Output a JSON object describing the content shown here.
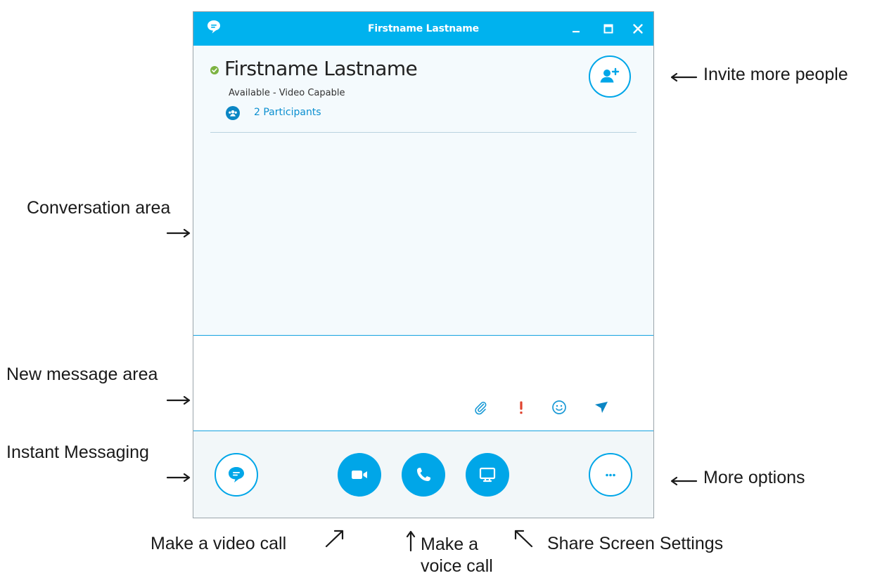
{
  "window": {
    "title": "Firstname Lastname",
    "accent_color": "#00b2ee",
    "controls": {
      "minimize_icon": "minimize-icon",
      "maximize_icon": "maximize-icon",
      "close_icon": "close-icon"
    }
  },
  "contact": {
    "name": "Firstname Lastname",
    "status": "Available - Video Capable",
    "presence_color": "#7cb342",
    "participants_label": "2 Participants"
  },
  "compose": {
    "placeholder": "",
    "tools": [
      "paperclip-icon",
      "exclamation-icon",
      "smiley-icon",
      "send-icon"
    ]
  },
  "toolbar": {
    "buttons": [
      "chat-bubble-icon",
      "video-camera-icon",
      "phone-icon",
      "monitor-icon",
      "ellipsis-icon"
    ]
  },
  "annotations": {
    "invite": "Invite more people",
    "conversation_area": "Conversation area",
    "new_message_area": "New message area",
    "instant_messaging": "Instant Messaging",
    "more_options": "More options",
    "video_call": "Make a video call",
    "voice_call_line1": "Make a",
    "voice_call_line2": "voice call",
    "share_screen": "Share Screen Settings"
  }
}
